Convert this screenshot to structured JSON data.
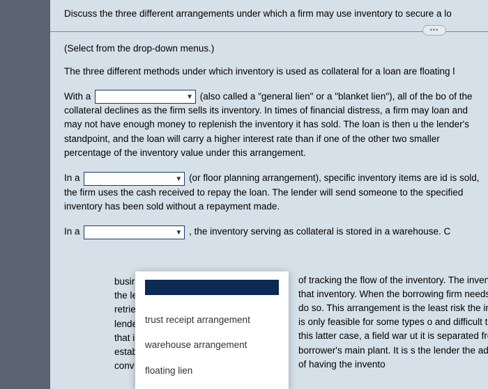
{
  "question": "Discuss the three different arrangements under which a firm may use inventory to secure a lo",
  "show_more": "•••",
  "instruction": "(Select from the drop-down menus.)",
  "intro": "The three different methods under which inventory is used as collateral for a loan are floating l",
  "block1": {
    "prefix": "With a",
    "after_dd": "(also called a \"general lien\" or a \"blanket lien\"), all of the bo",
    "rest": "of the collateral declines as the firm sells its inventory. In times of financial distress, a firm may loan and may not have enough money to replenish the inventory it has sold. The loan is then u the lender's standpoint, and the loan will carry a higher interest rate than if one of the other two smaller percentage of the inventory value under this arrangement."
  },
  "block2": {
    "prefix": "In a",
    "after_dd": "(or floor planning arrangement), specific inventory items are id",
    "rest": "is sold, the firm uses the cash received to repay the loan. The lender will send someone to the specified inventory has been sold without a repayment made."
  },
  "block3": {
    "prefix": "In a",
    "after_dd": ", the inventory serving as collateral is stored in a warehouse. C"
  },
  "left_frag": {
    "l1": "busir",
    "l2": "the le",
    "l3": "retrie",
    "l4": "lende",
    "l5": "that i",
    "l6": "estab",
    "l7": "conv"
  },
  "right_frag": "of tracking the flow of the inventory. The inventory is c lue of that inventory. When the borrowing firm needs he lender to do so. This arrangement is the least risk the inventory, but it is only feasible for some types o and difficult to transport. In this latter case, a field war ut it is separated from the borrower's main plant. It is s the lender the added security of having the invento",
  "dropdown": {
    "opt1": "trust receipt arrangement",
    "opt2": "warehouse arrangement",
    "opt3": "floating lien"
  }
}
